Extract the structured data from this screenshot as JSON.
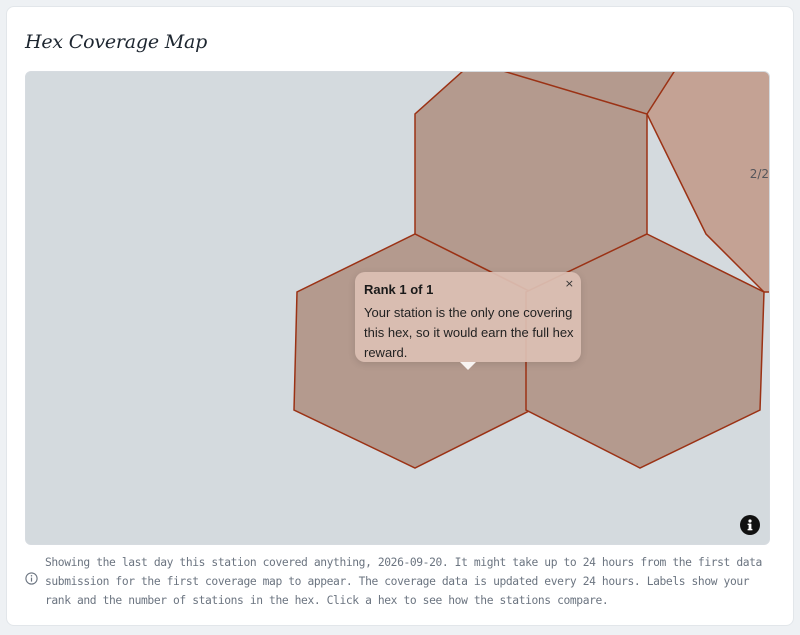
{
  "card": {
    "title": "Hex Coverage Map"
  },
  "map": {
    "page_indicator": "2/2",
    "hex_fill": "#b49a8e",
    "hex_fill_light": "#c4a294",
    "hex_stroke": "#9b3215",
    "background": "#d4dade"
  },
  "popup": {
    "title": "Rank 1 of 1",
    "body": "Your station is the only one covering this hex, so it would earn the full hex reward.",
    "close_label": "×"
  },
  "info_button": {
    "icon": "info-icon"
  },
  "footnote": {
    "icon": "info-circle-icon",
    "text": "Showing the last day this station covered anything, 2026-09-20. It might take up to 24 hours from the first data submission for the first coverage map to appear. The coverage data is updated every 24 hours. Labels show your rank and the number of stations in the hex. Click a hex to see how the stations compare."
  }
}
